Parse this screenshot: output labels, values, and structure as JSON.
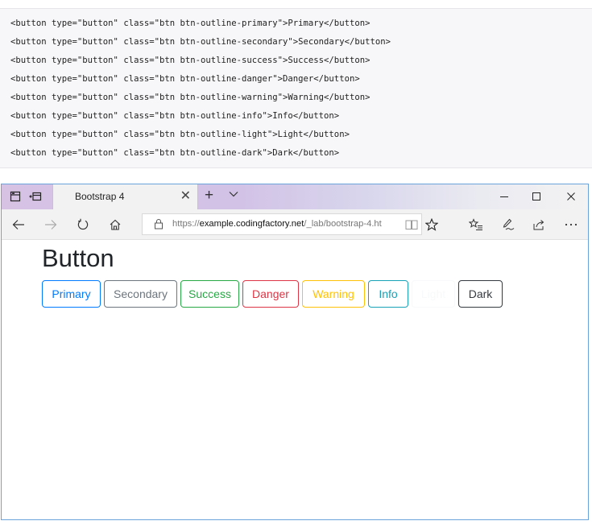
{
  "code_lines": [
    "<button type=\"button\" class=\"btn btn-outline-primary\">Primary</button>",
    "<button type=\"button\" class=\"btn btn-outline-secondary\">Secondary</button>",
    "<button type=\"button\" class=\"btn btn-outline-success\">Success</button>",
    "<button type=\"button\" class=\"btn btn-outline-danger\">Danger</button>",
    "<button type=\"button\" class=\"btn btn-outline-warning\">Warning</button>",
    "<button type=\"button\" class=\"btn btn-outline-info\">Info</button>",
    "<button type=\"button\" class=\"btn btn-outline-light\">Light</button>",
    "<button type=\"button\" class=\"btn btn-outline-dark\">Dark</button>"
  ],
  "browser": {
    "tab_title": "Bootstrap 4",
    "url_prefix": "https://",
    "url_host": "example.codingfactory.net",
    "url_path": "/_lab/bootstrap-4.ht"
  },
  "page": {
    "heading": "Button",
    "buttons": [
      {
        "label": "Primary",
        "color": "#007bff"
      },
      {
        "label": "Secondary",
        "color": "#6c757d"
      },
      {
        "label": "Success",
        "color": "#28a745"
      },
      {
        "label": "Danger",
        "color": "#dc3545"
      },
      {
        "label": "Warning",
        "color": "#ffc107"
      },
      {
        "label": "Info",
        "color": "#17a2b8"
      },
      {
        "label": "Light",
        "color": "#f8f9fa"
      },
      {
        "label": "Dark",
        "color": "#343a40"
      }
    ]
  }
}
